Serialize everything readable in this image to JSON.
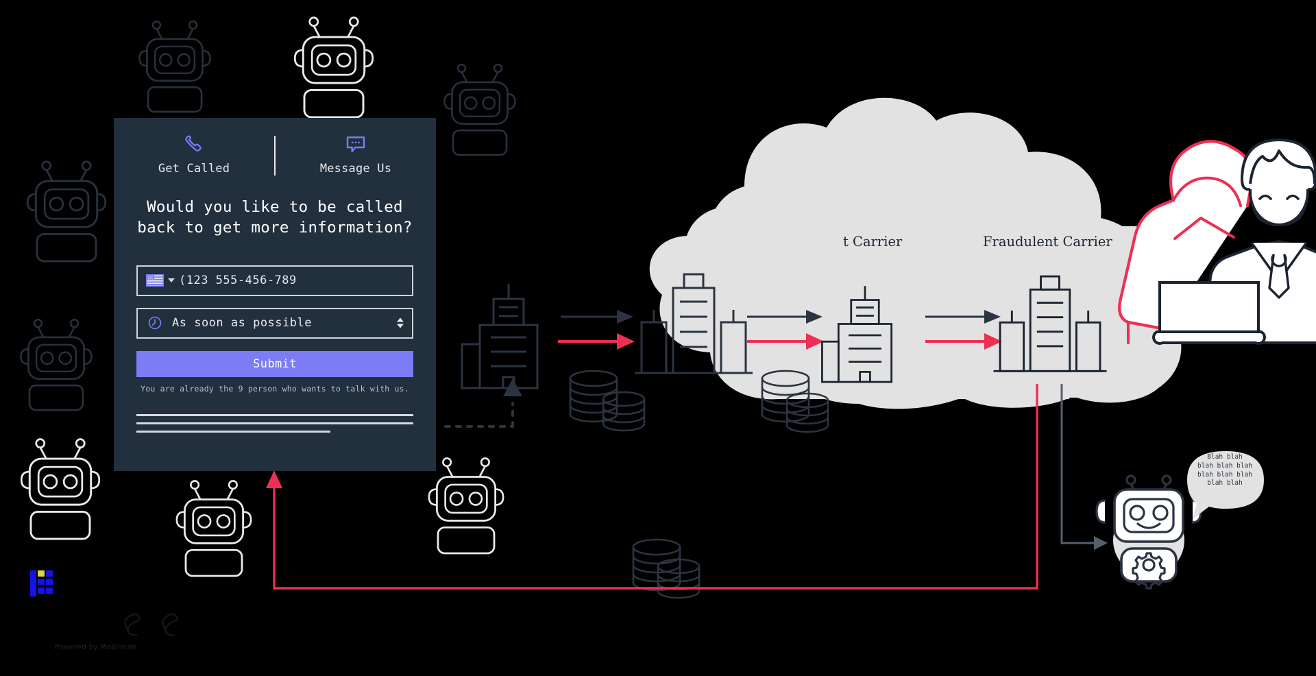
{
  "page": {
    "background_color": "#000000",
    "card_color": "#222f3d",
    "accent_color": "#7c7cf5",
    "danger_color": "#ef2e53",
    "ink_color": "#1b2430",
    "cloud_color": "#e2e2e2"
  },
  "widget": {
    "tabs": [
      {
        "label": "Get Called",
        "icon": "phone-icon",
        "selected": true
      },
      {
        "label": "Message Us",
        "icon": "chat-bubble-icon",
        "selected": false
      }
    ],
    "headline_line_1": "Would you like to be called",
    "headline_line_2": "back to get more information?",
    "phone_field": {
      "icon": "us-flag-icon",
      "value": "(123 555-456-789",
      "placeholder": "(123 555-456-789"
    },
    "time_select": {
      "icon": "clock-icon",
      "selected": "As soon as possible",
      "options": [
        "As soon as possible"
      ]
    },
    "submit_label": "Submit",
    "queue_note": "You are already the 9 person who wants to talk with us.",
    "skeleton_lines": 3
  },
  "footer": {
    "powered_by": "Powered by Mobileum",
    "logo_name": "mobileum-logo"
  },
  "diagram": {
    "labels": [
      {
        "name": "transit-carrier",
        "text": "t Carrier",
        "clipped": true
      },
      {
        "name": "fraudulent-carrier",
        "text": "Fraudulent Carrier",
        "clipped": false
      }
    ],
    "speech_bubble": {
      "line_1": "Blah blah",
      "line_2": "blah blah blah",
      "line_3": "blah blah blah",
      "line_4": "blah blah"
    },
    "figures": [
      "robot-outline",
      "office-building-icon",
      "city-skyline-icon",
      "coin-stack-icon",
      "arrow-right-icon",
      "hacker-hooded-figure",
      "businessman-at-laptop",
      "chatbot-with-gear-icon",
      "cloud-shape"
    ]
  }
}
